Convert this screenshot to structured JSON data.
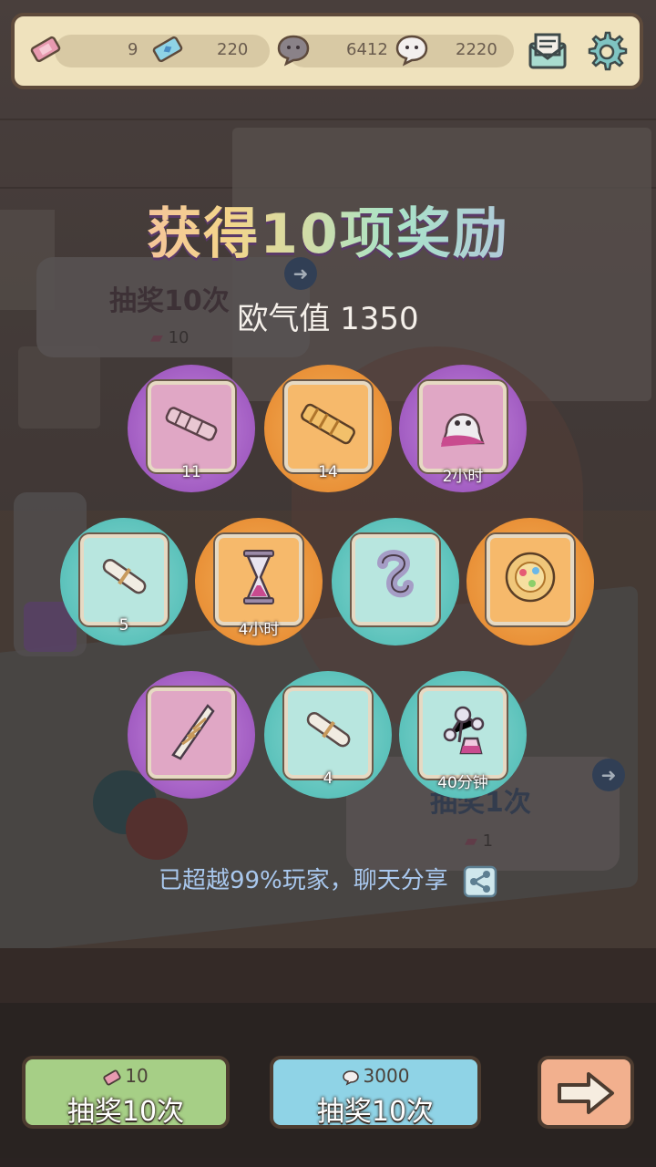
{
  "topbar": {
    "resources": [
      {
        "icon": "pink-ticket-icon",
        "value": "9"
      },
      {
        "icon": "blue-ticket-icon",
        "value": "220"
      },
      {
        "icon": "grey-speech-bubble-icon",
        "value": "6412"
      },
      {
        "icon": "white-ghost-bubble-icon",
        "value": "2220"
      }
    ],
    "mail_icon": "mail-icon",
    "settings_icon": "gear-icon"
  },
  "background_panels": {
    "left": {
      "title": "抽奖10次",
      "cost": "10"
    },
    "right": {
      "title": "抽奖1次",
      "cost": "1"
    }
  },
  "overlay": {
    "title": "获得10项奖励",
    "luck_label": "欧气值 1350"
  },
  "rewards": [
    {
      "icon": "telescope-icon",
      "color": "purple",
      "qty": "11"
    },
    {
      "icon": "gold-telescope-icon",
      "color": "orange",
      "qty": "14"
    },
    {
      "icon": "ghost-cloth-icon",
      "color": "purple",
      "qty": "2小时"
    },
    {
      "icon": "scroll-icon",
      "color": "teal",
      "qty": "5"
    },
    {
      "icon": "hourglass-icon",
      "color": "orange",
      "qty": "4小时"
    },
    {
      "icon": "glass-tube-icon",
      "color": "teal",
      "qty": ""
    },
    {
      "icon": "orb-plate-icon",
      "color": "orange",
      "qty": ""
    },
    {
      "icon": "crystal-wand-icon",
      "color": "purple",
      "qty": ""
    },
    {
      "icon": "scroll-icon",
      "color": "teal",
      "qty": "4"
    },
    {
      "icon": "molecule-flask-icon",
      "color": "teal",
      "qty": "40分钟"
    }
  ],
  "share": {
    "text": "已超越99%玩家，聊天分享",
    "icon": "share-icon"
  },
  "buttons": {
    "draw_ticket": {
      "cost": "10",
      "label": "抽奖10次",
      "icon": "pink-ticket-icon"
    },
    "draw_bubble": {
      "cost": "3000",
      "label": "抽奖10次",
      "icon": "speech-bubble-icon"
    },
    "next": {
      "icon": "right-arrow-icon"
    }
  },
  "colors": {
    "purple": "#a25dc2",
    "orange": "#e99138",
    "teal": "#5cc2bb"
  }
}
